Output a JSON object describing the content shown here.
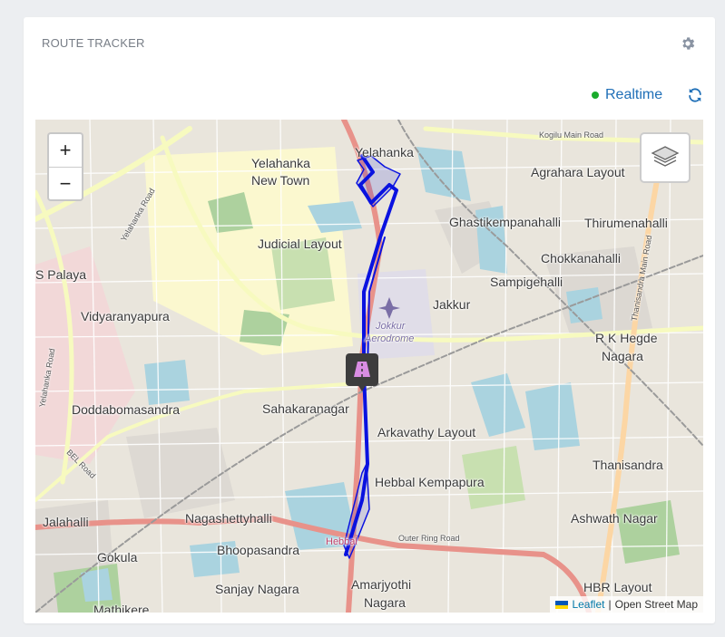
{
  "widget": {
    "title": "ROUTE TRACKER",
    "settings_icon": "gear-icon",
    "realtime_label": "Realtime",
    "realtime_status_color": "#1aab2c",
    "refresh_icon": "refresh-icon"
  },
  "map": {
    "zoom_in_label": "+",
    "zoom_out_label": "−",
    "layers_icon": "layers-icon",
    "marker_icon": "road-icon",
    "route_color": "#0a12e0",
    "attribution": {
      "leaflet_label": "Leaflet",
      "separator": "|",
      "source_label": "Open Street Map"
    },
    "places": [
      "Yelahanka",
      "Yelahanka",
      "New Town",
      "Kogilu Main Road",
      "Agrahara Layout",
      "Ghastikempanahalli",
      "Thirumenahalli",
      "Judicial Layout",
      "Chokkanahalli",
      "S Palaya",
      "Sampigehalli",
      "Jakkur",
      "Jokkur",
      "Aerodrome",
      "Vidyaranyapura",
      "R K Hegde",
      "Nagara",
      "Doddabomasandra",
      "Sahakaranagar",
      "Arkavathy Layout",
      "Thanisandra",
      "Hebbal Kempapura",
      "Jalahalli",
      "Nagashettyhalli",
      "Ashwath Nagar",
      "Gokula",
      "Bhoopasandra",
      "Hebbal",
      "Outer Ring Road",
      "Amarjyothi",
      "Nagara",
      "Sanjay Nagara",
      "Mathikere",
      "HBR Layout",
      "Yelahanka Road",
      "Thanisandra Main Road",
      "Yelahanka Road",
      "BEL Road"
    ]
  }
}
